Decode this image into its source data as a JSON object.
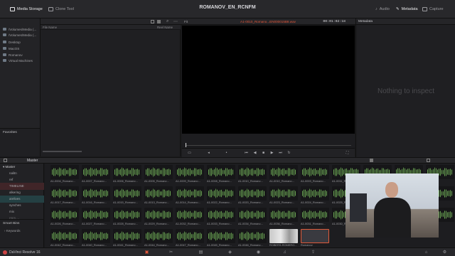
{
  "window": {
    "title": "ROMANOV_EN_RCNFM"
  },
  "topbar": {
    "media_storage": "Media Storage",
    "clone_tool": "Clone Tool",
    "audio": "Audio",
    "metadata": "Metadata",
    "capture": "Capture"
  },
  "storage": {
    "volumes": [
      "/Volumes/Media (...",
      "/Volumes/Media (...",
      "Desktop",
      "MacOS",
      "Romanov",
      "Virtual Machines"
    ]
  },
  "favorites": {
    "label": "Favorites"
  },
  "filelist": {
    "col_file_name": "File Name",
    "col_reel_name": "Reel Name"
  },
  "viewer": {
    "fit": "Fit",
    "clip_name": "A1-0010_Romano...EN000015B8.wav",
    "timecode": "00:01:02:18"
  },
  "metadata_panel": {
    "header": "Metadata",
    "empty_text": "Nothing to inspect"
  },
  "bin": {
    "title": "Master"
  },
  "bins": {
    "master": "Master",
    "items": [
      "nalitn",
      "ref",
      "TIMELINE",
      "alkering",
      "arelives",
      "synches",
      "mix",
      "rmrs ..."
    ]
  },
  "smartbins": {
    "label": "Smart Bins",
    "keywords": "Keywords"
  },
  "clips": [
    "A1-0004_Romano...",
    "A1-0007_Romano...",
    "A1-0006_Romano...",
    "A1-0005_Romano...",
    "A1-0009_Romano...",
    "A1-0008_Romano...",
    "A1-0010_Romano...",
    "A1-0010_Romano...",
    "A1-0003_Romano...",
    "A1-0011_Romano...",
    "",
    "",
    "",
    "A1-0017_Romano...",
    "A1-0016_Romano...",
    "A1-0015_Romano...",
    "A1-0013_Romano...",
    "A1-0014_Romano...",
    "A1-0022_Romano...",
    "A1-0020_Romano...",
    "A1-0023_Romano...",
    "A1-0024_Romano...",
    "A1-0025_Romano...",
    "",
    "",
    "",
    "A1-0026_Romano...",
    "A1-0027_Romano...",
    "A1-0028_Romano...",
    "A1-0029_Romano...",
    "A1-0032_Romano...",
    "A1-0033_Romano...",
    "A1-0034_Romano...",
    "A1-0036_Romano...",
    "A1-0031_Romano...",
    "A1-0030_Romano...",
    "",
    "",
    "",
    "A1-0042_Romano...",
    "A1-0040_Romano...",
    "A1-0041_Romano...",
    "A1-0044_Romano...",
    "A1-0047_Romano...",
    "A1-0045_Romano...",
    "A1-0046_Romano...",
    "ROBERS-ROMERO...",
    "Romanov"
  ],
  "statusbar": {
    "app_name": "DaVinci Resolve 16"
  }
}
